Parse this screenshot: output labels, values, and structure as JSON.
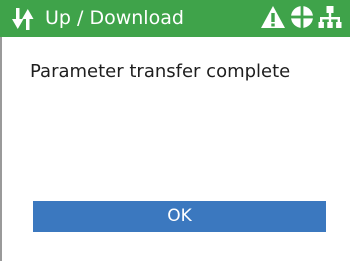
{
  "header": {
    "title": "Up / Download",
    "left_icon": "updown-transfer-icon",
    "right_icons": [
      "warning-icon",
      "target-icon",
      "network-icon"
    ],
    "bg_color": "#3fa34a"
  },
  "dialog": {
    "message": "Parameter transfer complete",
    "ok_label": "OK",
    "button_color": "#3b78bf"
  }
}
